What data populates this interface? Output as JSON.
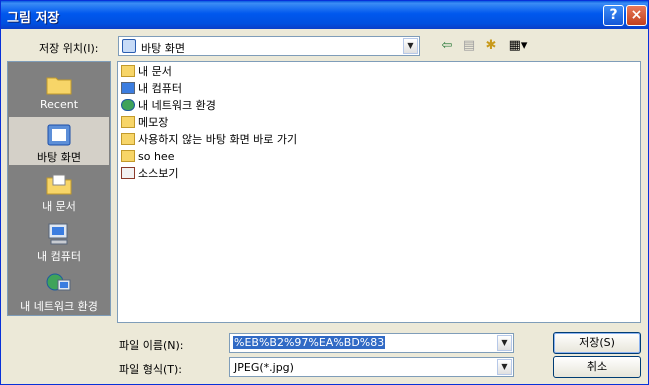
{
  "window": {
    "title": "그림 저장",
    "help_label": "?",
    "close_label": "×"
  },
  "location": {
    "label": "저장 위치(I):",
    "value": "바탕 화면"
  },
  "toolbar": {
    "back_icon": "back-arrow-icon",
    "up_icon": "up-folder-icon",
    "new_folder_icon": "new-folder-icon",
    "view_icon": "view-menu-icon"
  },
  "places": [
    {
      "label": "Recent",
      "icon": "recent-folder-icon"
    },
    {
      "label": "바탕 화면",
      "icon": "desktop-icon"
    },
    {
      "label": "내 문서",
      "icon": "my-documents-icon"
    },
    {
      "label": "내 컴퓨터",
      "icon": "my-computer-icon"
    },
    {
      "label": "내 네트워크 환경",
      "icon": "network-icon"
    }
  ],
  "files": [
    {
      "name": "내 문서",
      "icon": "my-documents-icon"
    },
    {
      "name": "내 컴퓨터",
      "icon": "my-computer-icon"
    },
    {
      "name": "내 네트워크 환경",
      "icon": "network-icon"
    },
    {
      "name": "메모장",
      "icon": "folder-icon"
    },
    {
      "name": "사용하지 않는 바탕 화면 바로 가기",
      "icon": "folder-icon"
    },
    {
      "name": "so hee",
      "icon": "folder-icon"
    },
    {
      "name": "소스보기",
      "icon": "shortcut-icon"
    }
  ],
  "filename": {
    "label": "파일 이름(N):",
    "value": "%EB%B2%97%EA%BD%83"
  },
  "filetype": {
    "label": "파일 형식(T):",
    "value": "JPEG(*.jpg)"
  },
  "buttons": {
    "save": "저장(S)",
    "cancel": "취소"
  }
}
